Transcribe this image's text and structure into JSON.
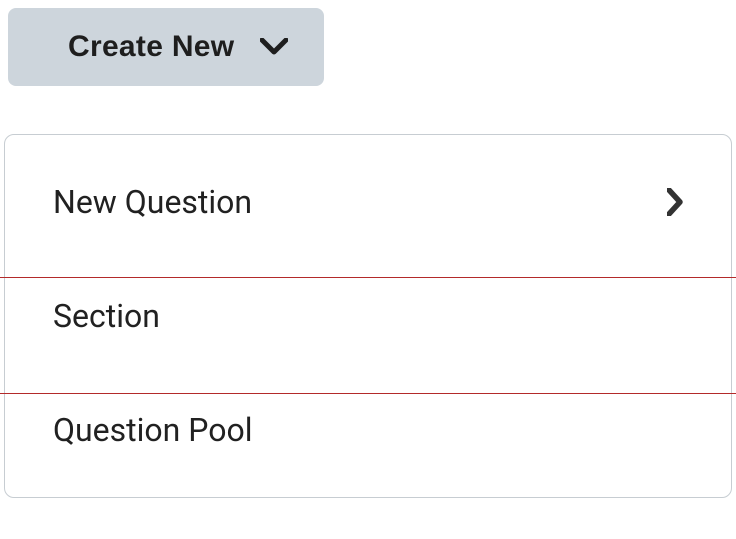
{
  "button": {
    "label": "Create New"
  },
  "menu": {
    "items": [
      {
        "label": "New Question",
        "has_submenu": true
      },
      {
        "label": "Section",
        "has_submenu": false,
        "highlighted": true
      },
      {
        "label": "Question Pool",
        "has_submenu": false
      }
    ]
  },
  "colors": {
    "button_bg": "#cdd5dc",
    "highlight_border": "#b32a2a",
    "panel_border": "#c7cdd2"
  }
}
